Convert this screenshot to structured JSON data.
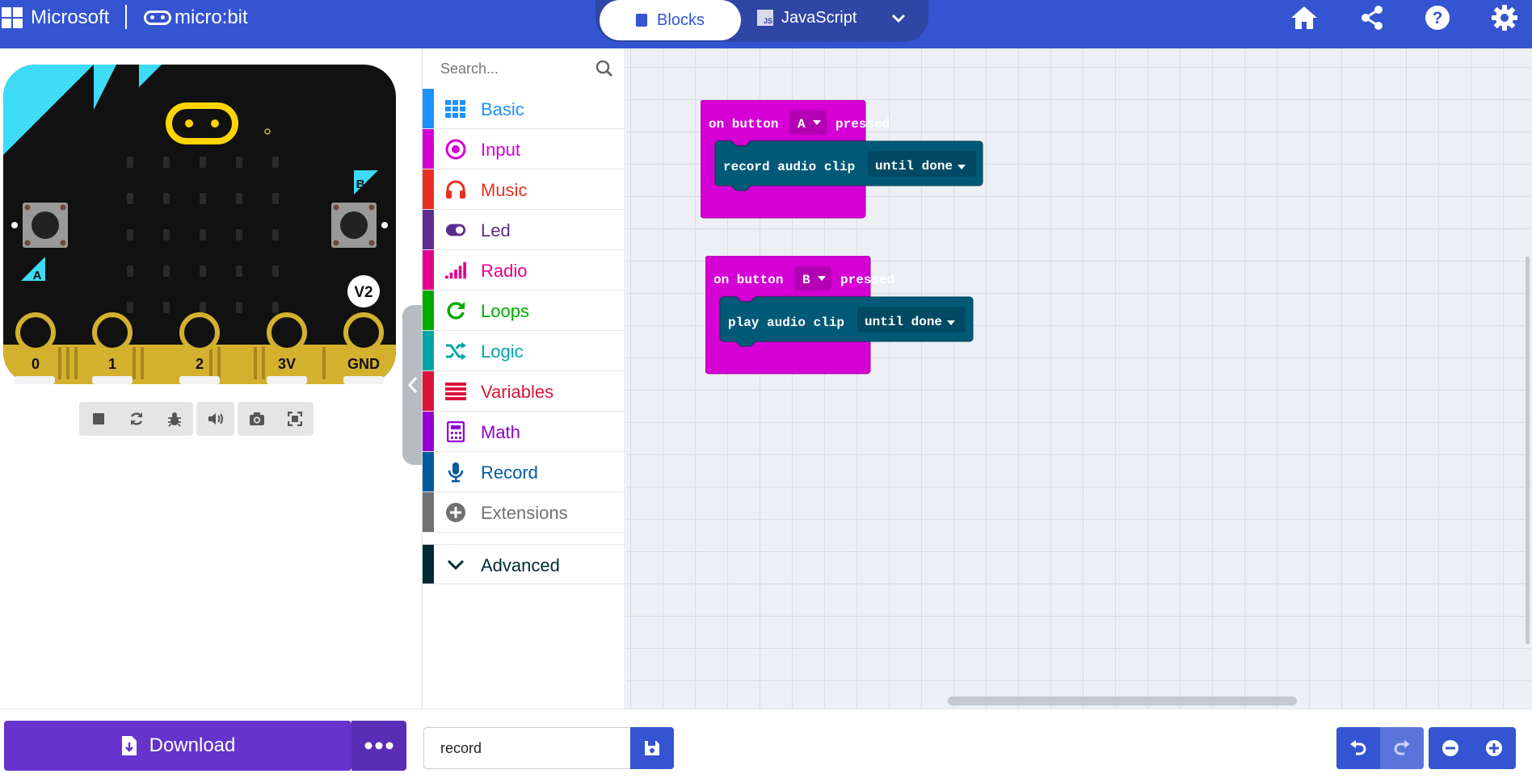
{
  "header": {
    "brand_microsoft": "Microsoft",
    "brand_microbit": "micro:bit",
    "tabs": [
      {
        "label": "Blocks",
        "active": true
      },
      {
        "label": "JavaScript",
        "active": false
      }
    ],
    "js_badge": "JS",
    "icons": [
      "home-icon",
      "share-icon",
      "help-icon",
      "settings-icon"
    ],
    "color": "#3454d1"
  },
  "simulator": {
    "pin_labels": [
      "0",
      "1",
      "2",
      "3V",
      "GND"
    ],
    "button_a": "A",
    "button_b": "B",
    "version_badge": "V2",
    "controls": [
      "stop-icon",
      "restart-icon",
      "debug-icon",
      "mute-icon",
      "screenshot-icon",
      "fullscreen-icon"
    ]
  },
  "toolbox": {
    "search_placeholder": "Search...",
    "categories": [
      {
        "label": "Basic",
        "color": "#1e90ff",
        "icon": "grid-icon"
      },
      {
        "label": "Input",
        "color": "#d400d4",
        "icon": "input-icon"
      },
      {
        "label": "Music",
        "color": "#e63022",
        "icon": "headphones-icon"
      },
      {
        "label": "Led",
        "color": "#5c2d91",
        "icon": "toggle-icon"
      },
      {
        "label": "Radio",
        "color": "#e3008c",
        "icon": "signal-icon"
      },
      {
        "label": "Loops",
        "color": "#00aa00",
        "icon": "loop-icon"
      },
      {
        "label": "Logic",
        "color": "#00a4a6",
        "icon": "shuffle-icon"
      },
      {
        "label": "Variables",
        "color": "#dc143c",
        "icon": "list-icon"
      },
      {
        "label": "Math",
        "color": "#9400d3",
        "icon": "calculator-icon"
      },
      {
        "label": "Record",
        "color": "#005a9e",
        "icon": "microphone-icon"
      },
      {
        "label": "Extensions",
        "color": "#717171",
        "icon": "plus-circle-icon"
      }
    ],
    "advanced": {
      "label": "Advanced",
      "color": "#002a33"
    }
  },
  "workspace": {
    "blocks": [
      {
        "event": "on button",
        "dropdown": "A",
        "suffix": "pressed",
        "inner_text": "record audio clip",
        "inner_dropdown": "until done"
      },
      {
        "event": "on button",
        "dropdown": "B",
        "suffix": "pressed",
        "inner_text": "play audio clip",
        "inner_dropdown": "until done"
      }
    ],
    "event_color": "#d400d4",
    "inner_color": "#005a77"
  },
  "bottombar": {
    "download_label": "Download",
    "project_name": "record",
    "icons": [
      "undo-icon",
      "redo-icon",
      "zoom-out-icon",
      "zoom-in-icon"
    ]
  }
}
